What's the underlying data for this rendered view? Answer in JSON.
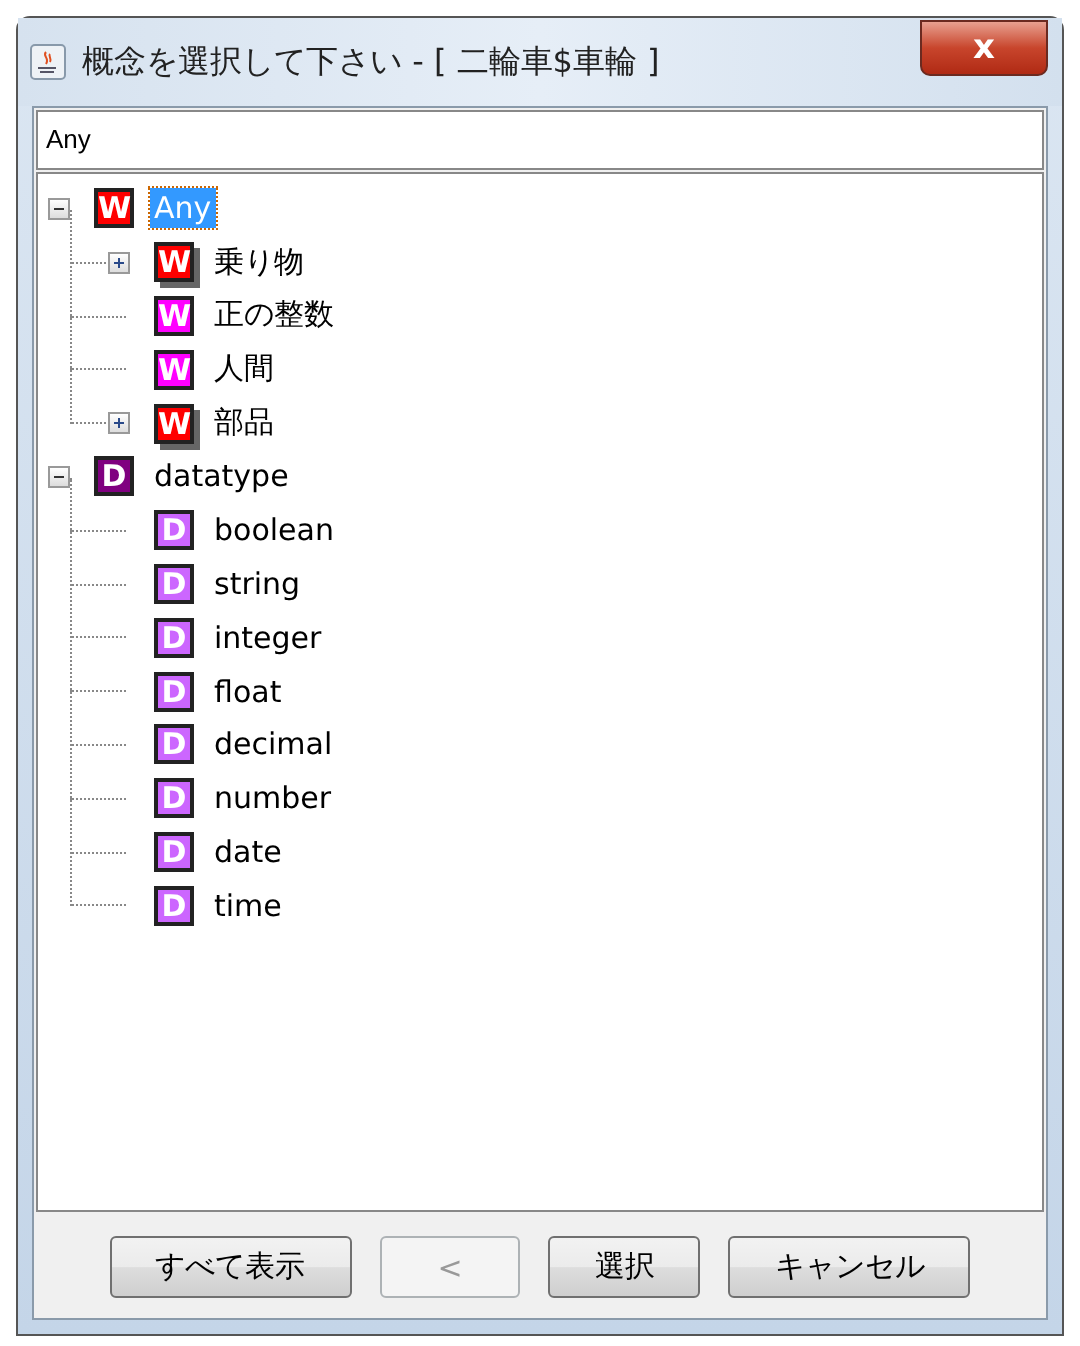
{
  "window": {
    "title": "概念を選択して下さい - [ 二輪車$車輪 ]",
    "close": "x"
  },
  "field": {
    "value": "Any"
  },
  "tree": [
    {
      "label": "Any",
      "badge": "W",
      "color": "#ff0000",
      "selected": true,
      "expanded": true,
      "children": [
        {
          "label": "乗り物",
          "badge": "W",
          "color": "#ff0000",
          "selected": false,
          "expanded": false,
          "has_children": true
        },
        {
          "label": "正の整数",
          "badge": "W",
          "color": "#ff00ff",
          "selected": false
        },
        {
          "label": "人間",
          "badge": "W",
          "color": "#ff00ff",
          "selected": false
        },
        {
          "label": "部品",
          "badge": "W",
          "color": "#ff0000",
          "selected": false,
          "expanded": false,
          "has_children": true
        }
      ]
    },
    {
      "label": "datatype",
      "badge": "D",
      "color": "#800080",
      "selected": false,
      "expanded": true,
      "children": [
        {
          "label": "boolean",
          "badge": "D",
          "color": "#cc66ff",
          "selected": false
        },
        {
          "label": "string",
          "badge": "D",
          "color": "#cc66ff",
          "selected": false
        },
        {
          "label": "integer",
          "badge": "D",
          "color": "#cc66ff",
          "selected": false
        },
        {
          "label": "float",
          "badge": "D",
          "color": "#cc66ff",
          "selected": false
        },
        {
          "label": "decimal",
          "badge": "D",
          "color": "#cc66ff",
          "selected": false
        },
        {
          "label": "number",
          "badge": "D",
          "color": "#cc66ff",
          "selected": false
        },
        {
          "label": "date",
          "badge": "D",
          "color": "#cc66ff",
          "selected": false
        },
        {
          "label": "time",
          "badge": "D",
          "color": "#cc66ff",
          "selected": false
        }
      ]
    }
  ],
  "buttons": [
    {
      "label": "すべて表示",
      "disabled": false
    },
    {
      "label": "<",
      "disabled": true
    },
    {
      "label": "選択",
      "disabled": false
    },
    {
      "label": "キャンセル",
      "disabled": false
    }
  ]
}
